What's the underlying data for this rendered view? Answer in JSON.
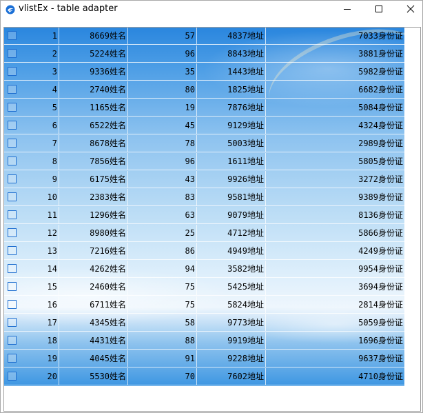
{
  "window": {
    "title": "vlistEx - table adapter"
  },
  "icons": {
    "app": "app-logo-icon",
    "minimize": "minimize-icon",
    "maximize": "maximize-icon",
    "close": "close-icon"
  },
  "colors": {
    "checkbox_border": "#1f6fd0",
    "grid_line": "#ffffff",
    "sky_top": "#2a86de",
    "sky_bottom": "#3d96e2"
  },
  "table": {
    "rows": [
      {
        "no": "1",
        "name": "8669姓名",
        "age": "57",
        "address": "4837地址",
        "id": "7033身份证"
      },
      {
        "no": "2",
        "name": "5224姓名",
        "age": "96",
        "address": "8843地址",
        "id": "3881身份证"
      },
      {
        "no": "3",
        "name": "9336姓名",
        "age": "35",
        "address": "1443地址",
        "id": "5982身份证"
      },
      {
        "no": "4",
        "name": "2740姓名",
        "age": "80",
        "address": "1825地址",
        "id": "6682身份证"
      },
      {
        "no": "5",
        "name": "1165姓名",
        "age": "19",
        "address": "7876地址",
        "id": "5084身份证"
      },
      {
        "no": "6",
        "name": "6522姓名",
        "age": "45",
        "address": "9129地址",
        "id": "4324身份证"
      },
      {
        "no": "7",
        "name": "8678姓名",
        "age": "78",
        "address": "5003地址",
        "id": "2989身份证"
      },
      {
        "no": "8",
        "name": "7856姓名",
        "age": "96",
        "address": "1611地址",
        "id": "5805身份证"
      },
      {
        "no": "9",
        "name": "6175姓名",
        "age": "43",
        "address": "9926地址",
        "id": "3272身份证"
      },
      {
        "no": "10",
        "name": "2383姓名",
        "age": "83",
        "address": "9581地址",
        "id": "9389身份证"
      },
      {
        "no": "11",
        "name": "1296姓名",
        "age": "63",
        "address": "9079地址",
        "id": "8136身份证"
      },
      {
        "no": "12",
        "name": "8980姓名",
        "age": "25",
        "address": "4712地址",
        "id": "5866身份证"
      },
      {
        "no": "13",
        "name": "7216姓名",
        "age": "86",
        "address": "4949地址",
        "id": "4249身份证"
      },
      {
        "no": "14",
        "name": "4262姓名",
        "age": "94",
        "address": "3582地址",
        "id": "9954身份证"
      },
      {
        "no": "15",
        "name": "2460姓名",
        "age": "75",
        "address": "5425地址",
        "id": "3694身份证"
      },
      {
        "no": "16",
        "name": "6711姓名",
        "age": "75",
        "address": "5824地址",
        "id": "2814身份证"
      },
      {
        "no": "17",
        "name": "4345姓名",
        "age": "58",
        "address": "9773地址",
        "id": "5059身份证"
      },
      {
        "no": "18",
        "name": "4431姓名",
        "age": "88",
        "address": "9919地址",
        "id": "1696身份证"
      },
      {
        "no": "19",
        "name": "4045姓名",
        "age": "91",
        "address": "9228地址",
        "id": "9637身份证"
      },
      {
        "no": "20",
        "name": "5530姓名",
        "age": "70",
        "address": "7602地址",
        "id": "4710身份证"
      }
    ]
  }
}
